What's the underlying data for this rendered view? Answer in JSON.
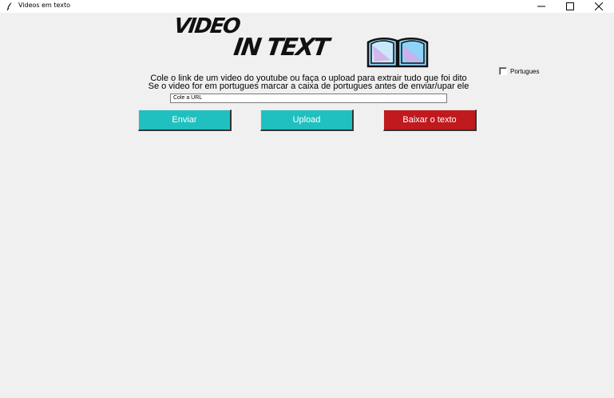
{
  "window": {
    "title": "Videos em texto",
    "icons": {
      "app": "feather-icon",
      "minimize": "minimize-icon",
      "maximize": "maximize-icon",
      "close": "close-icon"
    }
  },
  "logo": {
    "line1": "VIDEO",
    "line2": "IN TEXT",
    "icon": "book-icon"
  },
  "description": {
    "line1": "Cole o link de um video do youtube ou faça o upload para extrair tudo que foi dito",
    "line2": "Se o video for em portugues marcar a caixa de portugues antes de enviar/upar ele"
  },
  "checkbox": {
    "label": "Portugues",
    "checked": false
  },
  "url_input": {
    "value": "Cole a URL"
  },
  "buttons": {
    "enviar": {
      "label": "Enviar",
      "color": "#20c0c0"
    },
    "upload": {
      "label": "Upload",
      "color": "#20c0c0"
    },
    "baixar": {
      "label": "Baixar o texto",
      "color": "#c0191e"
    }
  },
  "colors": {
    "background": "#f0f0f0",
    "book_fill": "#8fd3f8",
    "book_accent": "#d8a8e8"
  }
}
